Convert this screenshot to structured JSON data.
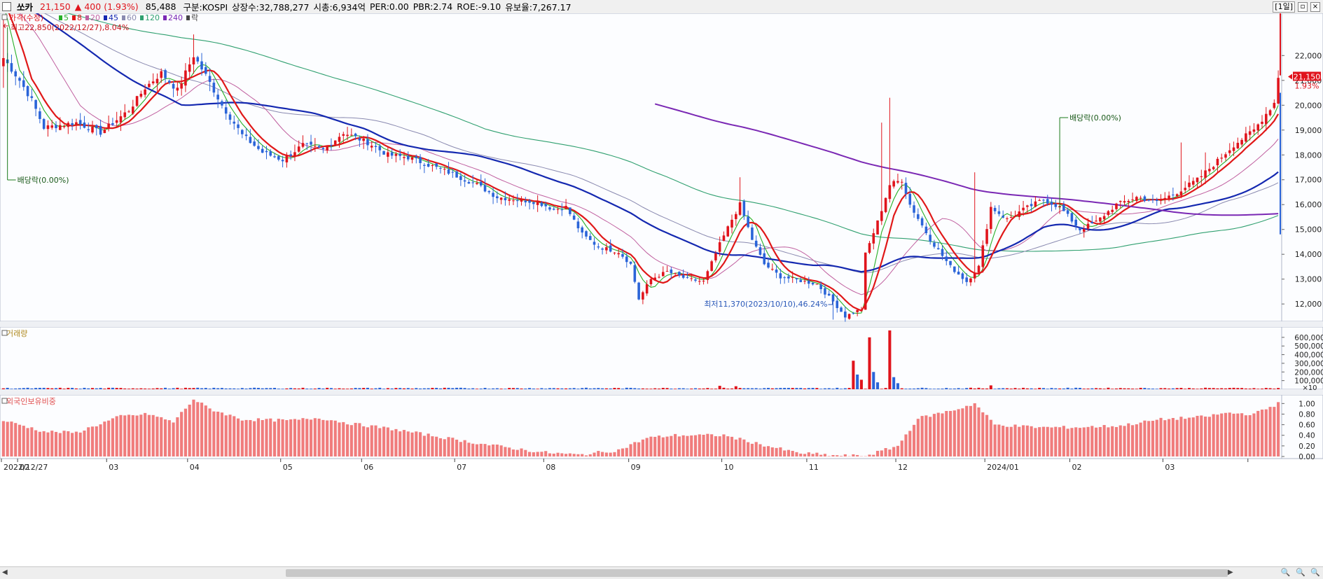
{
  "header": {
    "name": "쏘카",
    "price": "21,150",
    "change": "▲ 400",
    "change_pct": "(1.93%)",
    "volume": "85,488",
    "market": "구분:KOSPI",
    "shares": "상장수:32,788,277",
    "mcap": "시총:6,934억",
    "per": "PER:0.00",
    "pbr": "PBR:2.74",
    "roe": "ROE:-9.10",
    "float": "유보율:7,267.17",
    "period": "[1일]"
  },
  "legend": {
    "price": "가격(수정)",
    "ma": [
      "5",
      "8",
      "20",
      "45",
      "60",
      "120",
      "240"
    ],
    "ex": "락"
  },
  "annotations": {
    "high": "최고22,850(2022/12/27),8.04%",
    "low": "최저11,370(2023/10/10),46.24%",
    "div1": "배당락(0.00%)",
    "div2": "배당락(0.00%)",
    "last_price": "21,150",
    "last_pct": "1.93%"
  },
  "panels": {
    "volume_title": "거래량",
    "volume_unit": "×10",
    "foreign_title": "외국인보유비중"
  },
  "colors": {
    "up": "#e0141c",
    "down": "#2a64d8",
    "ma5": "#28b028",
    "ma8": "#e01818",
    "ma20": "#c060a0",
    "ma45": "#1428b0",
    "ma60": "#8a8ab0",
    "ma120": "#30a070",
    "ma240": "#7a28b4",
    "foreign": "#f07c7c"
  },
  "chart_data": [
    {
      "type": "candlestick",
      "title": "쏘카",
      "y_ticks": [
        12000,
        13000,
        14000,
        15000,
        16000,
        17000,
        18000,
        19000,
        20000,
        21000,
        22000
      ],
      "ylim": [
        11300,
        23700
      ],
      "x_ticks": [
        "2022/12/27",
        "02",
        "03",
        "04",
        "05",
        "06",
        "07",
        "08",
        "09",
        "10",
        "11",
        "12",
        "2024/01",
        "02",
        "03"
      ],
      "x_range": [
        "2022-12-27",
        "2024-03-12"
      ],
      "close_anchors": [
        [
          "2022-12-27",
          21900
        ],
        [
          "2023-01-02",
          21000
        ],
        [
          "2023-01-05",
          20200
        ],
        [
          "2023-01-10",
          19100
        ],
        [
          "2023-01-20",
          19300
        ],
        [
          "2023-01-30",
          18900
        ],
        [
          "2023-02-08",
          19800
        ],
        [
          "2023-02-14",
          20700
        ],
        [
          "2023-02-20",
          21300
        ],
        [
          "2023-02-24",
          20600
        ],
        [
          "2023-03-02",
          22000
        ],
        [
          "2023-03-07",
          21200
        ],
        [
          "2023-03-13",
          20000
        ],
        [
          "2023-03-20",
          18800
        ],
        [
          "2023-03-27",
          18100
        ],
        [
          "2023-04-03",
          17800
        ],
        [
          "2023-04-10",
          18400
        ],
        [
          "2023-04-17",
          18200
        ],
        [
          "2023-04-24",
          18900
        ],
        [
          "2023-05-02",
          18500
        ],
        [
          "2023-05-09",
          18000
        ],
        [
          "2023-05-16",
          17900
        ],
        [
          "2023-05-23",
          17600
        ],
        [
          "2023-05-30",
          17300
        ],
        [
          "2023-06-08",
          16800
        ],
        [
          "2023-06-15",
          16300
        ],
        [
          "2023-06-22",
          16200
        ],
        [
          "2023-06-29",
          16100
        ],
        [
          "2023-07-05",
          15800
        ],
        [
          "2023-07-10",
          15900
        ],
        [
          "2023-07-14",
          14800
        ],
        [
          "2023-07-20",
          14300
        ],
        [
          "2023-07-27",
          14100
        ],
        [
          "2023-08-01",
          13600
        ],
        [
          "2023-08-03",
          12200
        ],
        [
          "2023-08-08",
          13000
        ],
        [
          "2023-08-14",
          13300
        ],
        [
          "2023-08-21",
          13000
        ],
        [
          "2023-08-27",
          12900
        ],
        [
          "2023-08-31",
          14400
        ],
        [
          "2023-09-05",
          15400
        ],
        [
          "2023-09-07",
          16000
        ],
        [
          "2023-09-12",
          14600
        ],
        [
          "2023-09-15",
          13600
        ],
        [
          "2023-09-21",
          13100
        ],
        [
          "2023-10-04",
          12800
        ],
        [
          "2023-10-10",
          12100
        ],
        [
          "2023-10-15",
          11500
        ],
        [
          "2023-10-19",
          11800
        ],
        [
          "2023-10-20",
          14000
        ],
        [
          "2023-10-25",
          15300
        ],
        [
          "2023-10-30",
          16800
        ],
        [
          "2023-11-02",
          17000
        ],
        [
          "2023-11-06",
          16000
        ],
        [
          "2023-11-13",
          14600
        ],
        [
          "2023-11-20",
          13500
        ],
        [
          "2023-11-24",
          12900
        ],
        [
          "2023-11-29",
          13500
        ],
        [
          "2023-12-04",
          15900
        ],
        [
          "2023-12-08",
          15400
        ],
        [
          "2023-12-14",
          15800
        ],
        [
          "2023-12-21",
          16200
        ],
        [
          "2023-12-27",
          15900
        ],
        [
          "2024-01-03",
          15000
        ],
        [
          "2024-01-09",
          15300
        ],
        [
          "2024-01-16",
          16000
        ],
        [
          "2024-01-23",
          16300
        ],
        [
          "2024-01-30",
          16100
        ],
        [
          "2024-02-06",
          16500
        ],
        [
          "2024-02-13",
          17000
        ],
        [
          "2024-02-19",
          17600
        ],
        [
          "2024-02-26",
          18400
        ],
        [
          "2024-03-04",
          19000
        ],
        [
          "2024-03-11",
          20100
        ],
        [
          "2024-03-12",
          21150
        ]
      ]
    },
    {
      "type": "bar",
      "title": "거래량",
      "y_ticks": [
        100000,
        200000,
        300000,
        400000,
        500000,
        600000
      ],
      "ylim": [
        0,
        720000
      ],
      "unit": "×10",
      "spikes": [
        [
          "2023-10-17",
          330000,
          "up"
        ],
        [
          "2023-10-18",
          170000,
          "down"
        ],
        [
          "2023-10-19",
          110000,
          "up"
        ],
        [
          "2023-10-23",
          600000,
          "up"
        ],
        [
          "2023-10-24",
          200000,
          "down"
        ],
        [
          "2023-10-25",
          80000,
          "down"
        ],
        [
          "2023-10-30",
          680000,
          "up"
        ],
        [
          "2023-10-31",
          140000,
          "down"
        ],
        [
          "2023-11-01",
          70000,
          "down"
        ],
        [
          "2023-08-31",
          40000,
          "up"
        ],
        [
          "2023-09-06",
          35000,
          "up"
        ],
        [
          "2023-12-04",
          45000,
          "up"
        ]
      ],
      "base_volume": 12000
    },
    {
      "type": "bar",
      "title": "외국인보유비중",
      "y_ticks": [
        0.0,
        0.2,
        0.4,
        0.6,
        0.8,
        1.0
      ],
      "ylim": [
        0,
        1.15
      ],
      "anchors": [
        [
          "2022-12-27",
          0.68
        ],
        [
          "2023-01-03",
          0.58
        ],
        [
          "2023-01-10",
          0.47
        ],
        [
          "2023-01-20",
          0.45
        ],
        [
          "2023-02-06",
          0.76
        ],
        [
          "2023-02-15",
          0.8
        ],
        [
          "2023-02-23",
          0.65
        ],
        [
          "2023-03-02",
          1.08
        ],
        [
          "2023-03-08",
          0.9
        ],
        [
          "2023-03-20",
          0.7
        ],
        [
          "2023-04-05",
          0.68
        ],
        [
          "2023-04-14",
          0.73
        ],
        [
          "2023-04-26",
          0.62
        ],
        [
          "2023-05-10",
          0.52
        ],
        [
          "2023-05-25",
          0.38
        ],
        [
          "2023-06-09",
          0.24
        ],
        [
          "2023-06-30",
          0.08
        ],
        [
          "2023-07-13",
          0.03
        ],
        [
          "2023-07-27",
          0.12
        ],
        [
          "2023-08-07",
          0.35
        ],
        [
          "2023-08-16",
          0.4
        ],
        [
          "2023-09-01",
          0.4
        ],
        [
          "2023-09-13",
          0.25
        ],
        [
          "2023-09-27",
          0.07
        ],
        [
          "2023-10-10",
          0.02
        ],
        [
          "2023-10-20",
          0.01
        ],
        [
          "2023-11-01",
          0.2
        ],
        [
          "2023-11-08",
          0.72
        ],
        [
          "2023-11-22",
          0.9
        ],
        [
          "2023-11-28",
          1.0
        ],
        [
          "2023-12-05",
          0.6
        ],
        [
          "2023-12-20",
          0.55
        ],
        [
          "2024-01-02",
          0.55
        ],
        [
          "2024-01-17",
          0.58
        ],
        [
          "2024-01-31",
          0.7
        ],
        [
          "2024-02-15",
          0.75
        ],
        [
          "2024-02-22",
          0.82
        ],
        [
          "2024-03-04",
          0.8
        ],
        [
          "2024-03-12",
          1.0
        ]
      ]
    }
  ],
  "scrollbar": {
    "left": "◀",
    "right": "▶",
    "tools": "🔍 🔍 🔍"
  }
}
